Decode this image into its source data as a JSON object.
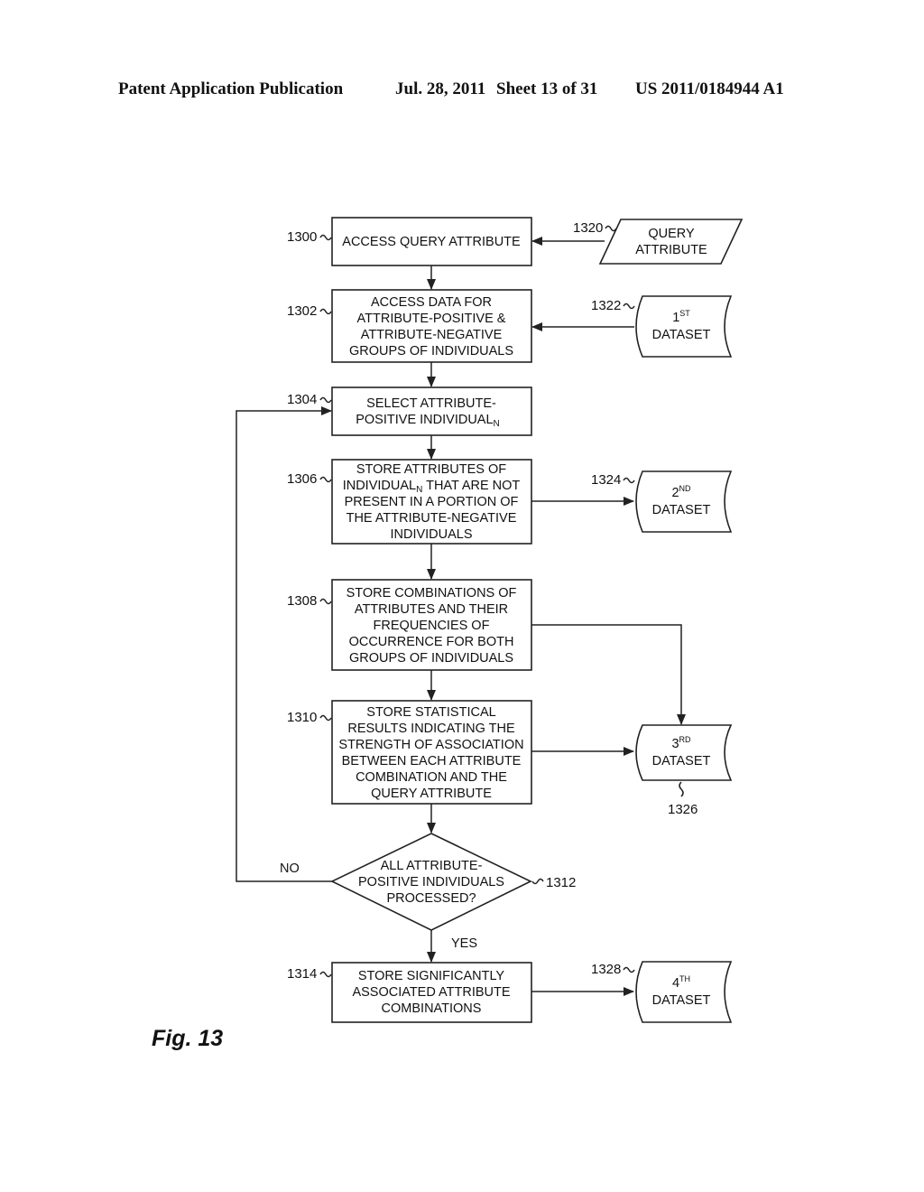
{
  "header": {
    "publication": "Patent Application Publication",
    "date": "Jul. 28, 2011",
    "sheet": "Sheet 13 of 31",
    "number": "US 2011/0184944 A1"
  },
  "figure_label": "Fig. 13",
  "steps": [
    {
      "ref": "1300",
      "lines": [
        "ACCESS QUERY ATTRIBUTE"
      ]
    },
    {
      "ref": "1302",
      "lines": [
        "ACCESS DATA FOR",
        "ATTRIBUTE-POSITIVE &",
        "ATTRIBUTE-NEGATIVE",
        "GROUPS OF INDIVIDUALS"
      ]
    },
    {
      "ref": "1304",
      "lines": [
        "SELECT ATTRIBUTE-",
        "POSITIVE INDIVIDUAL"
      ],
      "subscript": "N"
    },
    {
      "ref": "1306",
      "lines": [
        "STORE ATTRIBUTES OF",
        "INDIVIDUAL",
        "PRESENT IN A PORTION OF",
        "THE ATTRIBUTE-NEGATIVE",
        "INDIVIDUALS"
      ],
      "subscript": "N",
      "line2_suffix": " THAT ARE NOT"
    },
    {
      "ref": "1308",
      "lines": [
        "STORE COMBINATIONS OF",
        "ATTRIBUTES AND THEIR",
        "FREQUENCIES OF",
        "OCCURRENCE FOR BOTH",
        "GROUPS OF INDIVIDUALS"
      ]
    },
    {
      "ref": "1310",
      "lines": [
        "STORE STATISTICAL",
        "RESULTS INDICATING THE",
        "STRENGTH OF ASSOCIATION",
        "BETWEEN EACH ATTRIBUTE",
        "COMBINATION AND THE",
        "QUERY ATTRIBUTE"
      ]
    },
    {
      "ref": "1312",
      "lines": [
        "ALL ATTRIBUTE-",
        "POSITIVE INDIVIDUALS",
        "PROCESSED?"
      ]
    },
    {
      "ref": "1314",
      "lines": [
        "STORE SIGNIFICANTLY",
        "ASSOCIATED ATTRIBUTE",
        "COMBINATIONS"
      ]
    }
  ],
  "decision": {
    "no_label": "NO",
    "yes_label": "YES"
  },
  "inputs": [
    {
      "ref": "1320",
      "lines": [
        "QUERY",
        "ATTRIBUTE"
      ]
    }
  ],
  "datasets": [
    {
      "ref": "1322",
      "ordinal": "1",
      "suffix": "ST",
      "label": "DATASET"
    },
    {
      "ref": "1324",
      "ordinal": "2",
      "suffix": "ND",
      "label": "DATASET"
    },
    {
      "ref": "1326",
      "ordinal": "3",
      "suffix": "RD",
      "label": "DATASET"
    },
    {
      "ref": "1328",
      "ordinal": "4",
      "suffix": "TH",
      "label": "DATASET"
    }
  ]
}
